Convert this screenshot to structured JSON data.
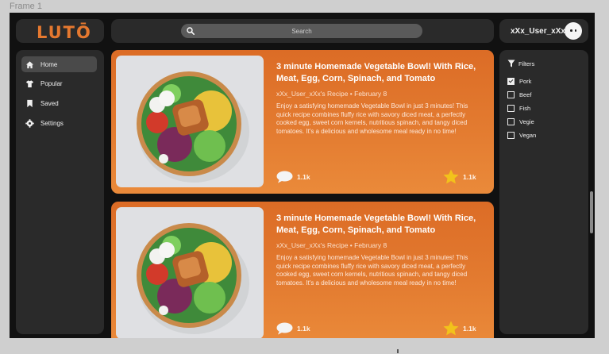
{
  "frame_label": "Frame 1",
  "brand": {
    "logo_text": "LUTŌ",
    "color": "#e5782f"
  },
  "search": {
    "placeholder": "Search"
  },
  "user": {
    "username": "xXx_User_xXx"
  },
  "sidebar": {
    "items": [
      {
        "label": "Home",
        "icon": "home-icon",
        "active": true
      },
      {
        "label": "Popular",
        "icon": "shirt-icon",
        "active": false
      },
      {
        "label": "Saved",
        "icon": "bookmark-icon",
        "active": false
      },
      {
        "label": "Settings",
        "icon": "gear-icon",
        "active": false
      }
    ]
  },
  "feed": {
    "posts": [
      {
        "title": "3 minute Homemade Vegetable Bowl! With Rice, Meat, Egg, Corn, Spinach, and Tomato",
        "meta": "xXx_User_xXx's Recipe • February 8",
        "description": "Enjoy a satisfying homemade Vegetable Bowl in just 3 minutes! This quick recipe combines fluffy rice with savory diced meat, a perfectly cooked egg, sweet corn kernels, nutritious spinach, and tangy diced tomatoes. It's a delicious and wholesome meal ready in no time!",
        "comments": "1.1k",
        "stars": "1.1k"
      },
      {
        "title": "3 minute Homemade Vegetable Bowl! With Rice, Meat, Egg, Corn, Spinach, and Tomato",
        "meta": "xXx_User_xXx's Recipe • February 8",
        "description": "Enjoy a satisfying homemade Vegetable Bowl in just 3 minutes! This quick recipe combines fluffy rice with savory diced meat, a perfectly cooked egg, sweet corn kernels, nutritious spinach, and tangy diced tomatoes. It's a delicious and wholesome meal ready in no time!",
        "comments": "1.1k",
        "stars": "1.1k"
      }
    ]
  },
  "filters": {
    "title": "Filters",
    "options": [
      {
        "label": "Pork",
        "checked": true
      },
      {
        "label": "Beef",
        "checked": false
      },
      {
        "label": "Fish",
        "checked": false
      },
      {
        "label": "Vegie",
        "checked": false
      },
      {
        "label": "Vegan",
        "checked": false
      }
    ]
  },
  "colors": {
    "accent": "#e37b30",
    "background": "#111111",
    "panel": "#2a2a2a",
    "star": "#f2c21b"
  }
}
